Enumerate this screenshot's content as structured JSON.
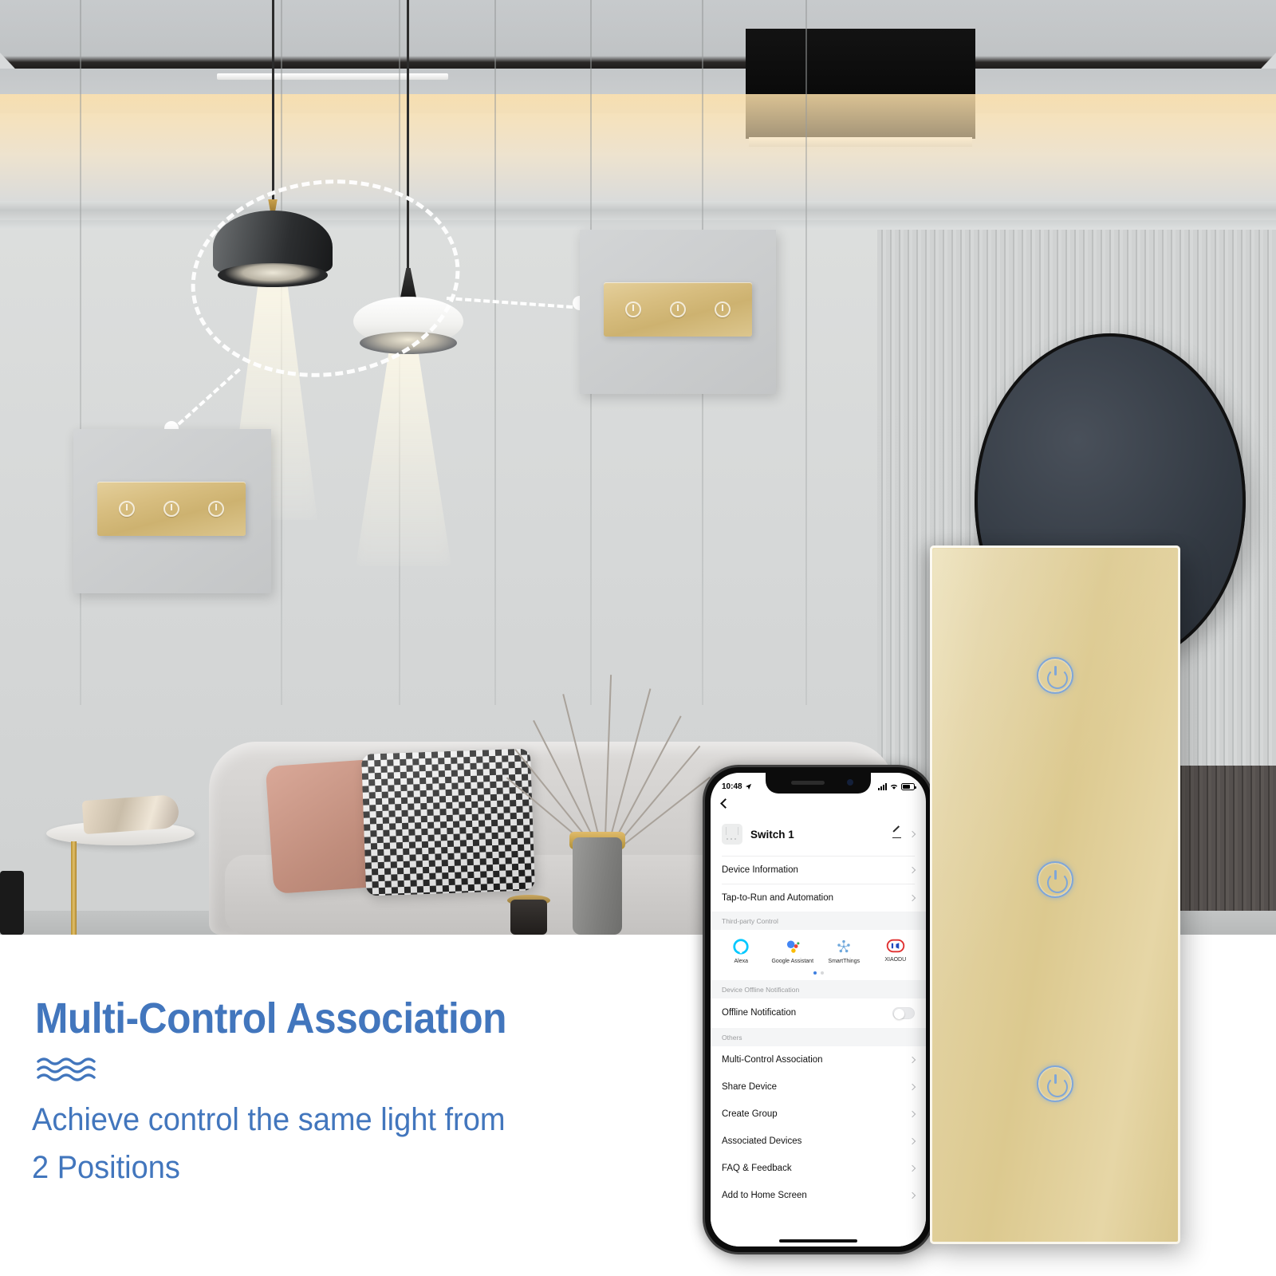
{
  "marketing": {
    "headline": "Multi-Control Association",
    "subtitle_line1": "Achieve control the same light from",
    "subtitle_line2": "2 Positions",
    "accent_color": "#4276bd",
    "wave_icon": "wave-lines-icon"
  },
  "scene": {
    "description": "Modern living room with two pendant lamps, sofa, side table and gold touch wall switches",
    "highlight_shape": "dashed-ellipse",
    "switch_plate_left": {
      "buttons": 3,
      "finish_color": "#d7bd7f"
    },
    "switch_plate_right": {
      "buttons": 3,
      "finish_color": "#d7bd7f"
    }
  },
  "product": {
    "name": "gold-glass-touch-switch",
    "finish_color": "#dcc98f",
    "indicator_color": "#7fa6d8",
    "buttons": [
      {
        "name": "power-key-1"
      },
      {
        "name": "power-key-2"
      },
      {
        "name": "power-key-3"
      }
    ]
  },
  "phone": {
    "statusbar": {
      "time": "10:48",
      "location_icon": "location-arrow-icon",
      "signal_icon": "cellular-bars-icon",
      "wifi_icon": "wifi-icon",
      "battery_icon": "battery-icon"
    },
    "nav": {
      "back_icon": "chevron-left-icon"
    },
    "device": {
      "thumb_icon": "switch-thumbnail-icon",
      "title": "Switch 1",
      "edit_icon": "pencil-icon",
      "chevron_icon": "chevron-right-icon"
    },
    "rows_top": [
      {
        "label": "Device Information",
        "chevron": "chevron-right-icon"
      },
      {
        "label": "Tap-to-Run and Automation",
        "chevron": "chevron-right-icon"
      }
    ],
    "third_party": {
      "header": "Third-party Control",
      "items": [
        {
          "label": "Alexa",
          "icon": "alexa-icon",
          "color": "#00c8ff"
        },
        {
          "label": "Google Assistant",
          "icon": "google-assistant-icon",
          "color": "#4285f4"
        },
        {
          "label": "SmartThings",
          "icon": "smartthings-icon",
          "color": "#6fa8dc"
        },
        {
          "label": "XIAODU",
          "icon": "xiaodu-icon",
          "color": "#e03131"
        }
      ],
      "pages": 2,
      "active_page": 1
    },
    "offline_section": {
      "header": "Device Offline Notification",
      "row_label": "Offline Notification",
      "toggle_state": "off"
    },
    "others_section": {
      "header": "Others",
      "rows": [
        {
          "label": "Multi-Control Association",
          "chevron": "chevron-right-icon"
        },
        {
          "label": "Share Device",
          "chevron": "chevron-right-icon"
        },
        {
          "label": "Create Group",
          "chevron": "chevron-right-icon"
        },
        {
          "label": "Associated Devices",
          "chevron": "chevron-right-icon"
        },
        {
          "label": "FAQ & Feedback",
          "chevron": "chevron-right-icon"
        },
        {
          "label": "Add to Home Screen",
          "chevron": "chevron-right-icon"
        }
      ]
    }
  }
}
